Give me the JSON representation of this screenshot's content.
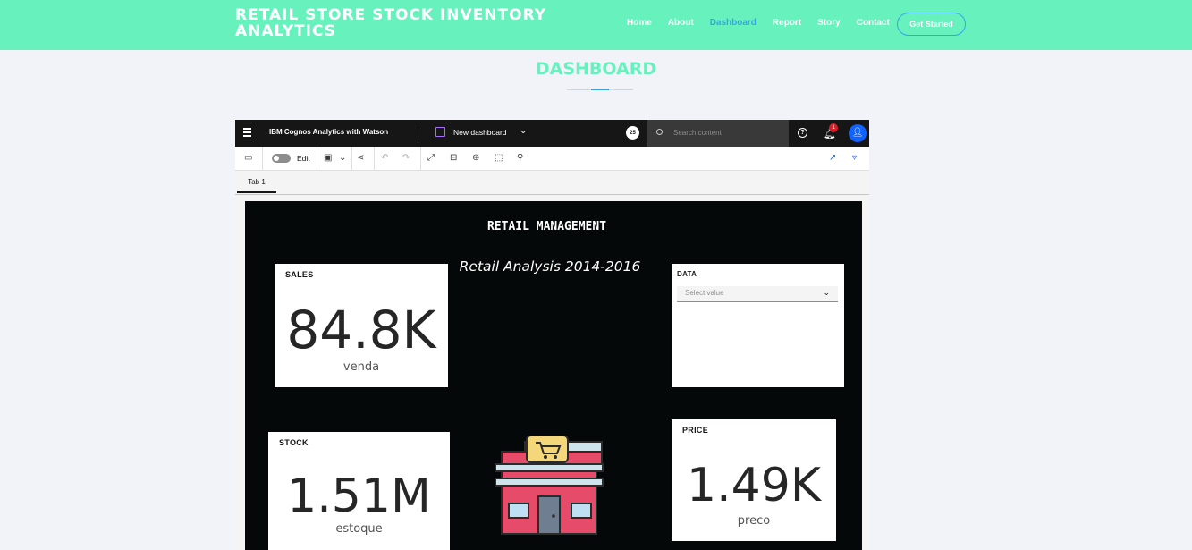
{
  "site": {
    "brand": "RETAIL STORE STOCK INVENTORY ANALYTICS",
    "nav": [
      {
        "label": "Home",
        "active": false
      },
      {
        "label": "About",
        "active": false
      },
      {
        "label": "Dashboard",
        "active": true
      },
      {
        "label": "Report",
        "active": false
      },
      {
        "label": "Story",
        "active": false
      },
      {
        "label": "Contact",
        "active": false
      }
    ],
    "cta": "Get Started",
    "colors": {
      "header_bg": "#67f2bd",
      "accent": "#35a5ea"
    }
  },
  "page": {
    "title": "DASHBOARD"
  },
  "cognos": {
    "product": "IBM Cognos Analytics with Watson",
    "dashboard_name": "New dashboard",
    "avatar_text": "25",
    "search_placeholder": "Search content",
    "notification_count": "1",
    "edit_label": "Edit",
    "tab_label": "Tab 1",
    "icons": [
      "menu-icon",
      "dashboard-icon",
      "chevron-down-icon",
      "search-icon",
      "help-icon",
      "bell-icon",
      "user-icon",
      "comment-icon",
      "save-icon",
      "share-icon",
      "undo-icon",
      "redo-icon",
      "expand-icon",
      "widget-icon",
      "filter-icon",
      "select-icon",
      "pin-icon",
      "chart-icon",
      "palette-icon"
    ]
  },
  "report": {
    "title": "RETAIL MANAGEMENT",
    "subtitle": "Retail Analysis 2014-2016",
    "sales": {
      "label": "SALES",
      "value": "84.8K",
      "sub": "venda"
    },
    "data_filter": {
      "label": "DATA",
      "placeholder": "Select value"
    },
    "stock": {
      "label": "STOCK",
      "value": "1.51M",
      "sub": "estoque"
    },
    "price": {
      "label": "PRICE",
      "value": "1.49K",
      "sub": "preco"
    },
    "image": "store-icon"
  }
}
